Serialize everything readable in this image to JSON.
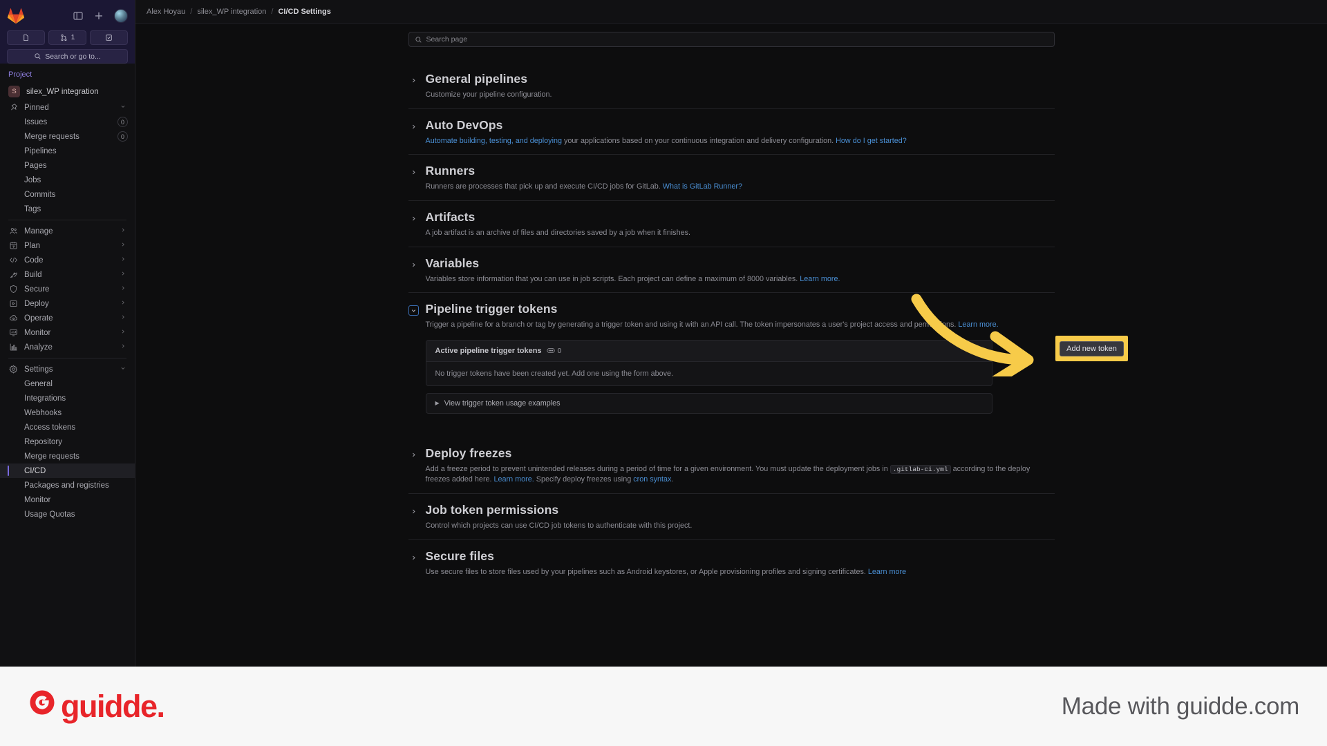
{
  "sidebar": {
    "search_placeholder": "Search or go to...",
    "merge_badge": "1",
    "project_label": "Project",
    "project_initial": "S",
    "project_name": "silex_WP integration",
    "pinned_label": "Pinned",
    "pinned_items": [
      {
        "label": "Issues",
        "badge": "0"
      },
      {
        "label": "Merge requests",
        "badge": "0"
      },
      {
        "label": "Pipelines",
        "badge": ""
      },
      {
        "label": "Pages",
        "badge": ""
      },
      {
        "label": "Jobs",
        "badge": ""
      },
      {
        "label": "Commits",
        "badge": ""
      },
      {
        "label": "Tags",
        "badge": ""
      }
    ],
    "groups": [
      {
        "label": "Manage",
        "icon": "users-icon"
      },
      {
        "label": "Plan",
        "icon": "calendar-icon"
      },
      {
        "label": "Code",
        "icon": "code-icon"
      },
      {
        "label": "Build",
        "icon": "rocket-icon"
      },
      {
        "label": "Secure",
        "icon": "shield-icon"
      },
      {
        "label": "Deploy",
        "icon": "deploy-icon"
      },
      {
        "label": "Operate",
        "icon": "cloud-gear-icon"
      },
      {
        "label": "Monitor",
        "icon": "monitor-icon"
      },
      {
        "label": "Analyze",
        "icon": "chart-icon"
      }
    ],
    "settings_label": "Settings",
    "settings_items": [
      {
        "label": "General",
        "active": false
      },
      {
        "label": "Integrations",
        "active": false
      },
      {
        "label": "Webhooks",
        "active": false
      },
      {
        "label": "Access tokens",
        "active": false
      },
      {
        "label": "Repository",
        "active": false
      },
      {
        "label": "Merge requests",
        "active": false
      },
      {
        "label": "CI/CD",
        "active": true
      },
      {
        "label": "Packages and registries",
        "active": false
      },
      {
        "label": "Monitor",
        "active": false
      },
      {
        "label": "Usage Quotas",
        "active": false
      }
    ]
  },
  "breadcrumb": {
    "user": "Alex Hoyau",
    "project": "silex_WP integration",
    "page": "CI/CD Settings",
    "separator": "/"
  },
  "search_page": {
    "placeholder": "Search page"
  },
  "sections": [
    {
      "title": "General pipelines",
      "desc_parts": [
        {
          "t": "Customize your pipeline configuration.",
          "link": false
        }
      ],
      "expanded": false
    },
    {
      "title": "Auto DevOps",
      "desc_parts": [
        {
          "t": "Automate building, testing, and deploying",
          "link": true
        },
        {
          "t": " your applications based on your continuous integration and delivery configuration. ",
          "link": false
        },
        {
          "t": "How do I get started?",
          "link": true
        }
      ],
      "expanded": false
    },
    {
      "title": "Runners",
      "desc_parts": [
        {
          "t": "Runners are processes that pick up and execute CI/CD jobs for GitLab. ",
          "link": false
        },
        {
          "t": "What is GitLab Runner?",
          "link": true
        }
      ],
      "expanded": false
    },
    {
      "title": "Artifacts",
      "desc_parts": [
        {
          "t": "A job artifact is an archive of files and directories saved by a job when it finishes.",
          "link": false
        }
      ],
      "expanded": false
    },
    {
      "title": "Variables",
      "desc_parts": [
        {
          "t": "Variables store information that you can use in job scripts. Each project can define a maximum of 8000 variables. ",
          "link": false
        },
        {
          "t": "Learn more.",
          "link": true
        }
      ],
      "expanded": false
    }
  ],
  "trigger_section": {
    "title": "Pipeline trigger tokens",
    "desc_parts": [
      {
        "t": "Trigger a pipeline for a branch or tag by generating a trigger token and using it with an API call. The token impersonates a user's project access and permissions. ",
        "link": false
      },
      {
        "t": "Learn more.",
        "link": true
      }
    ],
    "card_title": "Active pipeline trigger tokens",
    "card_count": "0",
    "empty_text": "No trigger tokens have been created yet. Add one using the form above.",
    "examples_label": "View trigger token usage examples",
    "add_button": "Add new token"
  },
  "bottom_sections": [
    {
      "title": "Deploy freezes",
      "desc_parts": [
        {
          "t": "Add a freeze period to prevent unintended releases during a period of time for a given environment. You must update the deployment jobs in ",
          "link": false
        },
        {
          "t": ".gitlab-ci.yml",
          "code": true
        },
        {
          "t": " according to the deploy freezes added here. ",
          "link": false
        },
        {
          "t": "Learn more.",
          "link": true
        },
        {
          "t": " Specify deploy freezes using ",
          "link": false
        },
        {
          "t": "cron syntax",
          "link": true
        },
        {
          "t": ".",
          "link": false
        }
      ]
    },
    {
      "title": "Job token permissions",
      "desc_parts": [
        {
          "t": "Control which projects can use CI/CD job tokens to authenticate with this project.",
          "link": false
        }
      ]
    },
    {
      "title": "Secure files",
      "desc_parts": [
        {
          "t": "Use secure files to store files used by your pipelines such as Android keystores, or Apple provisioning profiles and signing certificates. ",
          "link": false
        },
        {
          "t": "Learn more",
          "link": true
        }
      ]
    }
  ],
  "footer": {
    "brand": "guidde",
    "brand_dot": ".",
    "made_with": "Made with guidde.com"
  },
  "colors": {
    "highlight_yellow": "#f7cb49",
    "link_blue": "#4a8fd4",
    "accent_purple": "#8f7fe0",
    "brand_red": "#e8252a"
  }
}
